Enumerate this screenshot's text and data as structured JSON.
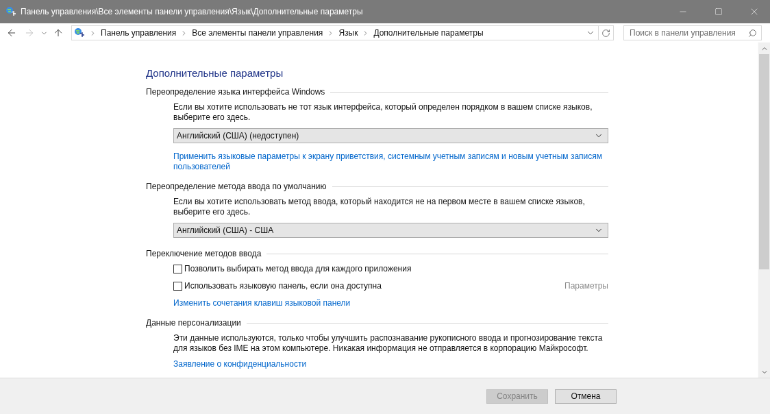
{
  "window": {
    "title": "Панель управления\\Все элементы панели управления\\Язык\\Дополнительные параметры"
  },
  "nav": {
    "back_enabled": true,
    "forward_enabled": false,
    "breadcrumb": [
      "Панель управления",
      "Все элементы панели управления",
      "Язык",
      "Дополнительные параметры"
    ],
    "search": {
      "placeholder": "Поиск в панели управления"
    }
  },
  "heading": "Дополнительные параметры",
  "sections": [
    {
      "title": "Переопределение языка интерфейса Windows",
      "items": [
        {
          "kind": "text",
          "text": "Если вы хотите использовать не тот язык интерфейса, который определен порядком в вашем списке языков, выберите его здесь."
        },
        {
          "kind": "dropdown",
          "value": "Английский (США) (недоступен)"
        },
        {
          "kind": "link",
          "text": "Применить языковые параметры к экрану приветствия, системным учетным записям и новым учетным записям пользователей"
        }
      ]
    },
    {
      "title": "Переопределение метода ввода по умолчанию",
      "items": [
        {
          "kind": "text",
          "text": "Если вы хотите использовать метод ввода, который находится не на первом месте в вашем списке языков, выберите его здесь."
        },
        {
          "kind": "dropdown",
          "value": "Английский (США) - США"
        }
      ]
    },
    {
      "title": "Переключение методов ввода",
      "items": [
        {
          "kind": "checkbox",
          "label": "Позволить выбирать метод ввода для каждого приложения",
          "checked": false
        },
        {
          "kind": "checkbox",
          "label": "Использовать языковую панель, если она доступна",
          "checked": false,
          "action": {
            "text": "Параметры",
            "disabled": true
          }
        },
        {
          "kind": "link",
          "text": "Изменить сочетания клавиш языковой панели"
        }
      ]
    },
    {
      "title": "Данные персонализации",
      "items": [
        {
          "kind": "text",
          "text": "Эти данные используются, только чтобы улучшить распознавание рукописного ввода и прогнозирование текста для языков без IME на этом компьютере. Никакая информация не отправляется в корпорацию Майкрософт."
        },
        {
          "kind": "link",
          "text": "Заявление о конфиденциальности"
        }
      ]
    }
  ],
  "footer": {
    "buttons": [
      {
        "label": "Сохранить",
        "disabled": true
      },
      {
        "label": "Отмена",
        "disabled": false
      }
    ]
  }
}
